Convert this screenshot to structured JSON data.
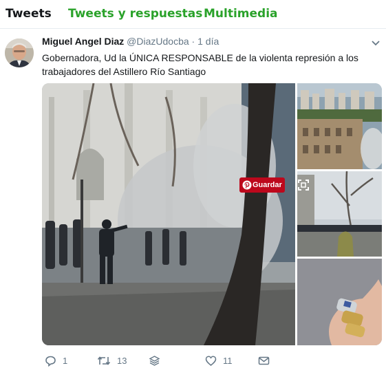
{
  "tabs": [
    {
      "label": "Tweets",
      "color": "#14171a"
    },
    {
      "label": "Tweets y respuestas",
      "color": "#2aa22a"
    },
    {
      "label": "Multimedia",
      "color": "#2aa22a"
    }
  ],
  "tweet": {
    "author_name": "Miguel Angel Diaz",
    "handle": "@DiazUdocba",
    "separator": "·",
    "time": "1 día",
    "text": "Gobernadora, Ud la ÚNICA RESPONSABLE de la violenta represión a los trabajadores del Astillero Río Santiago",
    "media": {
      "save_label": "Guardar",
      "save_color": "#bd081c",
      "icons": [
        "pinterest-icon",
        "expand-icon"
      ]
    },
    "actions": {
      "reply_count": "1",
      "retweet_count": "13",
      "like_count": "11",
      "icons": [
        "reply-icon",
        "retweet-icon",
        "stack-icon",
        "heart-icon",
        "envelope-icon"
      ]
    }
  }
}
